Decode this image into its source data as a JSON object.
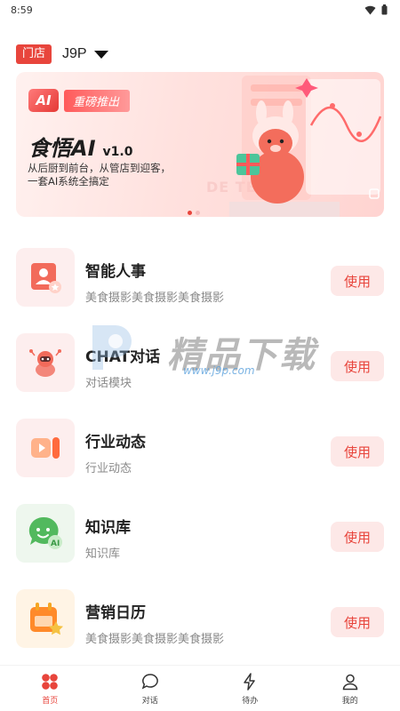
{
  "status_bar": {
    "time": "8:59"
  },
  "store": {
    "tag": "门店",
    "name": "J9P"
  },
  "banner": {
    "ai_logo": "AI",
    "badge": "重磅推出",
    "title": "食悟AI",
    "version": "v1.0",
    "line1": "从后厨到前台，从管店到迎客，",
    "line2": "一套AI系统全搞定",
    "watermark": "DE    TER"
  },
  "features": [
    {
      "title": "智能人事",
      "subtitle": "美食摄影美食摄影美食摄影",
      "button": "使用",
      "icon": "person-card-icon",
      "color": "#ff6b6b"
    },
    {
      "title": "CHAT对话",
      "subtitle": "对话模块",
      "button": "使用",
      "icon": "robot-icon",
      "color": "#ff6b6b"
    },
    {
      "title": "行业动态",
      "subtitle": "行业动态",
      "button": "使用",
      "icon": "video-camera-icon",
      "color": "#ff9a5a"
    },
    {
      "title": "知识库",
      "subtitle": "知识库",
      "button": "使用",
      "icon": "chat-ai-icon",
      "color": "#5bbf6a"
    },
    {
      "title": "营销日历",
      "subtitle": "美食摄影美食摄影美食摄影",
      "button": "使用",
      "icon": "calendar-icon",
      "color": "#f5a623"
    }
  ],
  "watermark": {
    "text": "精品下载",
    "url": "www.j9p.com"
  },
  "tabbar": [
    {
      "label": "首页",
      "icon": "home-grid-icon",
      "active": true
    },
    {
      "label": "对话",
      "icon": "chat-bubble-icon",
      "active": false
    },
    {
      "label": "待办",
      "icon": "lightning-icon",
      "active": false
    },
    {
      "label": "我的",
      "icon": "user-icon",
      "active": false
    }
  ],
  "colors": {
    "accent": "#e8453c",
    "button_bg": "#fde8e7"
  }
}
